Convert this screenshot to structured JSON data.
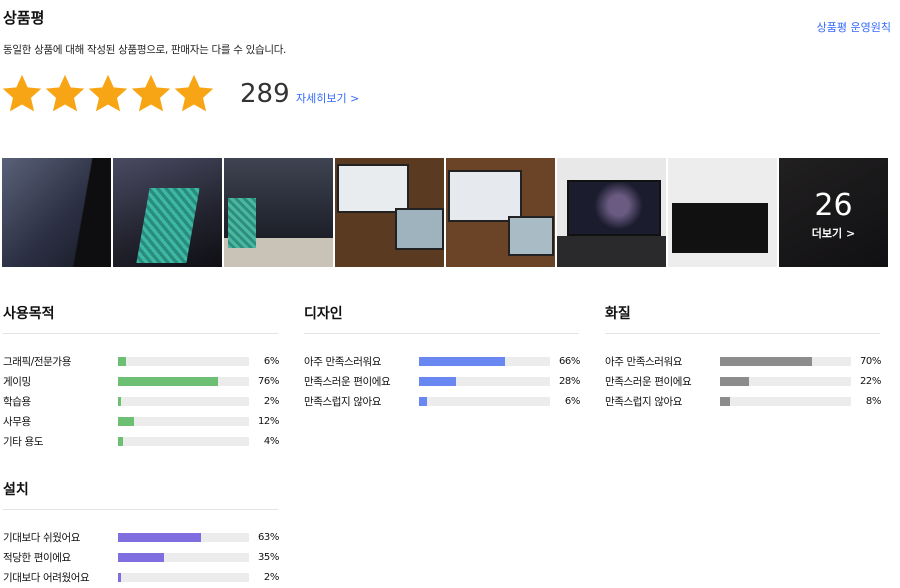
{
  "header": {
    "title": "상품평",
    "policy_link": "상품평 운영원칙",
    "description": "동일한 상품에 대해 작성된 상품평으로, 판매자는 다를 수 있습니다."
  },
  "rating": {
    "stars": 5,
    "count": "289",
    "detail_link": "자세히보기 >"
  },
  "photos": {
    "more_count": "26",
    "more_label": "더보기 >"
  },
  "colors": {
    "star": "#f8a515",
    "green": "#6dbf73",
    "blue": "#6987f0",
    "gray": "#8c8c8c",
    "purple": "#7f6ee0",
    "link": "#346aff"
  },
  "sections": {
    "purpose": {
      "title": "사용목적",
      "rows": [
        {
          "label": "그래픽/전문가용",
          "pct": "6%",
          "value": 6
        },
        {
          "label": "게이밍",
          "pct": "76%",
          "value": 76
        },
        {
          "label": "학습용",
          "pct": "2%",
          "value": 2
        },
        {
          "label": "사무용",
          "pct": "12%",
          "value": 12
        },
        {
          "label": "기타 용도",
          "pct": "4%",
          "value": 4
        }
      ]
    },
    "design": {
      "title": "디자인",
      "rows": [
        {
          "label": "아주 만족스러워요",
          "pct": "66%",
          "value": 66
        },
        {
          "label": "만족스러운 편이에요",
          "pct": "28%",
          "value": 28
        },
        {
          "label": "만족스럽지 않아요",
          "pct": "6%",
          "value": 6
        }
      ]
    },
    "quality": {
      "title": "화질",
      "rows": [
        {
          "label": "아주 만족스러워요",
          "pct": "70%",
          "value": 70
        },
        {
          "label": "만족스러운 편이에요",
          "pct": "22%",
          "value": 22
        },
        {
          "label": "만족스럽지 않아요",
          "pct": "8%",
          "value": 8
        }
      ]
    },
    "install": {
      "title": "설치",
      "rows": [
        {
          "label": "기대보다 쉬웠어요",
          "pct": "63%",
          "value": 63
        },
        {
          "label": "적당한 편이에요",
          "pct": "35%",
          "value": 35
        },
        {
          "label": "기대보다 어려웠어요",
          "pct": "2%",
          "value": 2
        }
      ]
    }
  }
}
